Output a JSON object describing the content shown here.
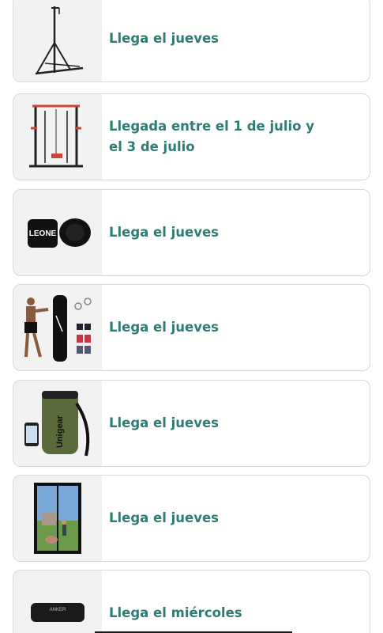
{
  "items": [
    {
      "delivery": "Llega el jueves",
      "icon": "freestanding-bag-stand-image"
    },
    {
      "delivery": "Llegada entre el 1 de julio y el 3 de julio",
      "icon": "power-rack-image"
    },
    {
      "delivery": "Llega el jueves",
      "icon": "leone-hand-wraps-image"
    },
    {
      "delivery": "Llega el jueves",
      "icon": "punching-bag-set-image"
    },
    {
      "delivery": "Llega el jueves",
      "icon": "unigear-dry-bag-image"
    },
    {
      "delivery": "Llega el jueves",
      "icon": "magnetic-screen-door-image"
    },
    {
      "delivery": "Llega el miércoles",
      "icon": "anker-speaker-image"
    }
  ],
  "image_texts": {
    "leone": "LEONE",
    "unigear": "Unigear",
    "anker": "ANKER"
  },
  "colors": {
    "accent_text": "#2e7c74",
    "card_border": "#d5d9d9",
    "thumb_bg": "#f2f2f2"
  }
}
